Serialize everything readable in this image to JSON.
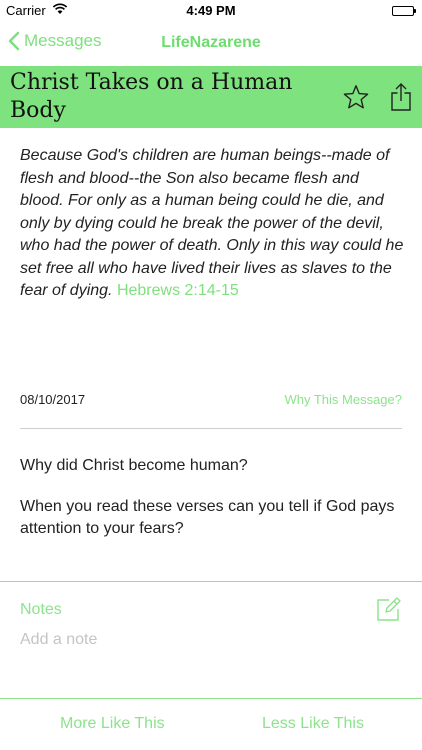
{
  "status_bar": {
    "carrier": "Carrier",
    "time": "4:49 PM",
    "battery_level": 1.0
  },
  "nav": {
    "back_label": "Messages",
    "title": "LifeNazarene"
  },
  "message": {
    "title": "Christ Takes on a Human Body",
    "verse_text": "Because God's children are human beings--made of flesh and blood--the Son also became flesh and blood. For only as a human being could he die, and only by dying could he break the power of the devil, who had the power of death. Only in this way could he set free all who have lived their lives as slaves to the fear of dying.",
    "verse_reference": "Hebrews 2:14-15",
    "date": "08/10/2017",
    "why_link": "Why This Message?",
    "question_1": "Why did Christ become human?",
    "question_2": "When you read these verses can you tell if God pays attention to your fears?"
  },
  "notes": {
    "label": "Notes",
    "placeholder": "Add a note",
    "value": ""
  },
  "actions": {
    "more_label": "More Like This",
    "less_label": "Less Like This"
  },
  "colors": {
    "accent": "#7ee27e",
    "link": "#8be48b",
    "text": "#222222",
    "divider": "#cfcfcf"
  },
  "icons": [
    "back-chevron-icon",
    "wifi-icon",
    "battery-icon",
    "star-icon",
    "share-icon",
    "edit-note-icon"
  ]
}
